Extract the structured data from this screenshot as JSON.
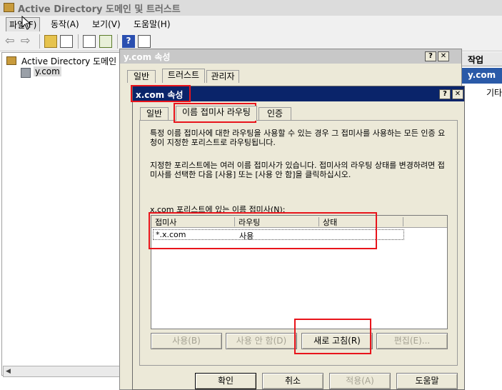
{
  "main_window": {
    "title": "Active Directory 도메인 및 트러스트",
    "menu": [
      "파일(F)",
      "동작(A)",
      "보기(V)",
      "도움말(H)"
    ],
    "tree": {
      "root": "Active Directory 도메인 및",
      "child": "y.com"
    },
    "actions": {
      "header": "작업",
      "selected": "y.com",
      "other": "기타"
    }
  },
  "outer_dialog": {
    "title": "y.com 속성",
    "tabs": [
      "일반",
      "트러스트",
      "관리자"
    ],
    "help_glyph": "?",
    "close_glyph": "✕"
  },
  "dialog": {
    "title": "x.com 속성",
    "tabs": [
      "일반",
      "이름 접미사 라우팅",
      "인증"
    ],
    "desc1": "특정 이름 접미사에 대한 라우팅을 사용할 수 있는 경우 그 접미사를 사용하는 모든 인증 요청이 지정한 포리스트로 라우팅됩니다.",
    "desc2": "지정한 포리스트에는 여러 이름 접미사가 있습니다. 접미사의 라우팅 상태를 변경하려면 접미사를 선택한 다음 [사용] 또는 [사용 안 함]을 클릭하십시오.",
    "list_label": "x.com 포리스트에 있는 이름 접미사(N):",
    "columns": [
      "접미사",
      "라우팅",
      "상태"
    ],
    "rows": [
      {
        "suffix": "*.x.com",
        "routing": "사용",
        "status": ""
      }
    ],
    "buttons": {
      "enable": "사용(B)",
      "disable": "사용 안 함(D)",
      "refresh": "새로 고침(R)",
      "edit": "편집(E)..."
    },
    "footer": {
      "ok": "확인",
      "cancel": "취소",
      "apply": "적용(A)",
      "help": "도움말"
    },
    "help_glyph": "?",
    "close_glyph": "✕"
  }
}
